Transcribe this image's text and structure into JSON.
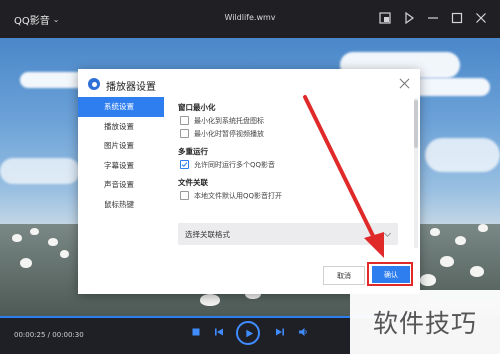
{
  "app": {
    "brand": "QQ影音",
    "file_title": "Wildlife.wmv"
  },
  "dialog": {
    "title": "播放器设置",
    "sidebar": [
      "系统设置",
      "播放设置",
      "图片设置",
      "字幕设置",
      "声音设置",
      "鼠标热键"
    ],
    "active_index": 0,
    "sections": {
      "minimize": {
        "title": "窗口最小化",
        "options": [
          {
            "label": "最小化到系统托盘图标",
            "checked": false
          },
          {
            "label": "最小化时暂停视频播放",
            "checked": false
          }
        ]
      },
      "multi": {
        "title": "多重运行",
        "options": [
          {
            "label": "允许同时运行多个QQ影音",
            "checked": true
          }
        ]
      },
      "assoc": {
        "title": "文件关联",
        "options": [
          {
            "label": "本地文件默认用QQ影音打开",
            "checked": false
          }
        ],
        "select_label": "选择关联格式"
      }
    },
    "cancel": "取消",
    "ok": "确认"
  },
  "player": {
    "time": "00:00:25 / 00:00:30",
    "progress_fraction": 0.833
  },
  "watermark": "软件技巧",
  "colors": {
    "accent": "#2f7ef0",
    "highlight": "#e02a2a",
    "titlebar": "#202024"
  },
  "icons": [
    "chevron-down-icon",
    "miniplayer-icon",
    "pin-icon",
    "minimize-icon",
    "maximize-icon",
    "close-icon",
    "stop-icon",
    "prev-icon",
    "play-icon",
    "next-icon",
    "volume-icon"
  ]
}
